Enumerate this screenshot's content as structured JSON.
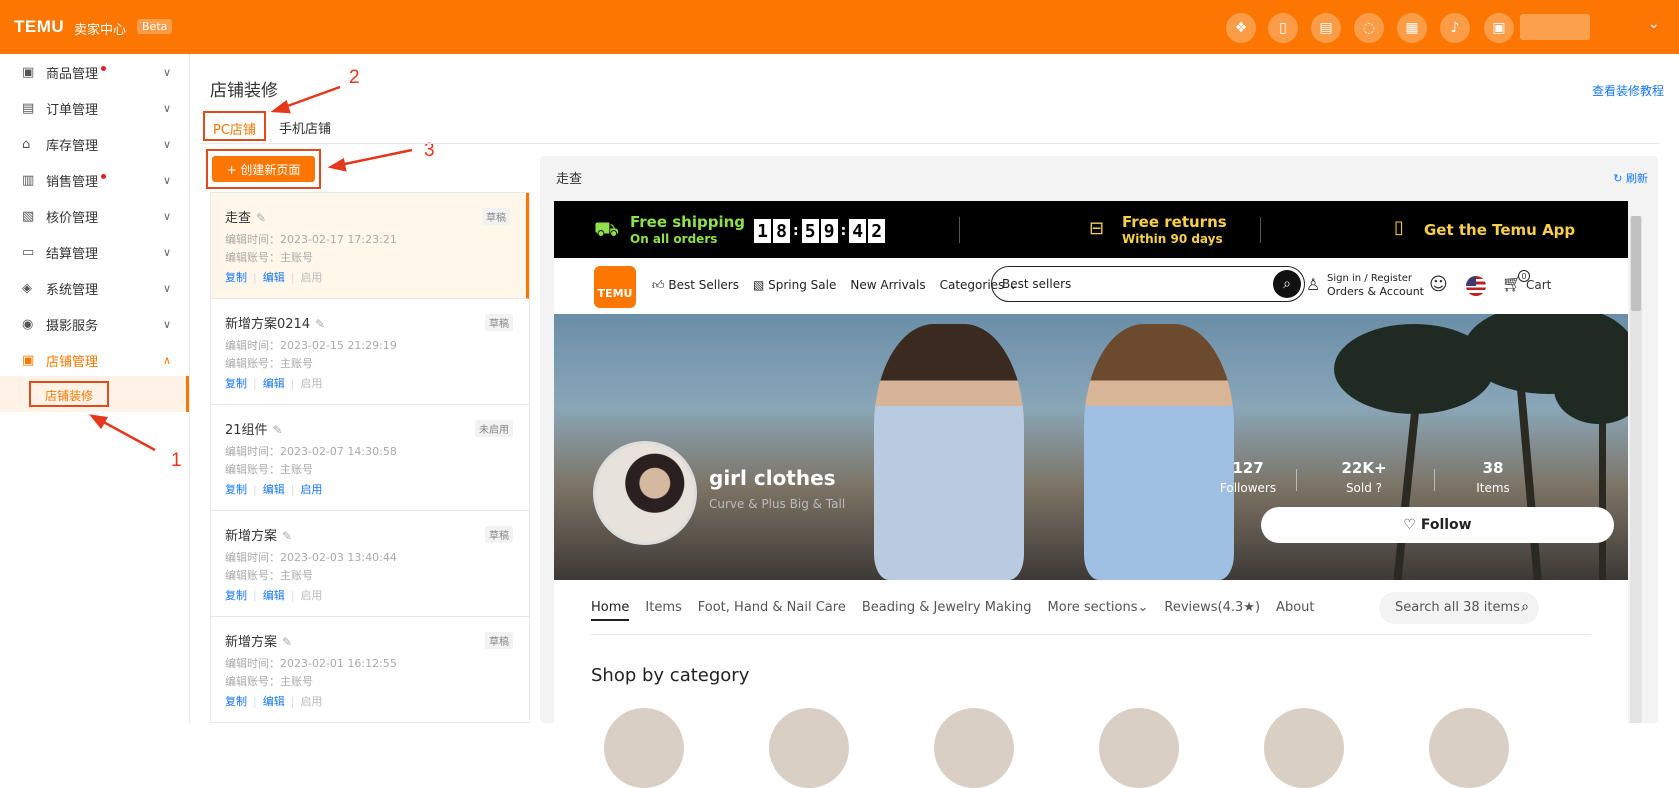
{
  "header": {
    "logo": "TEMU",
    "subtitle": "卖家中心",
    "badge": "Beta",
    "icons": [
      "handshake-icon",
      "phone-icon",
      "book-icon",
      "chat-icon",
      "document-icon",
      "bell-icon",
      "store-icon"
    ]
  },
  "sidebar": {
    "items": [
      {
        "label": "商品管理",
        "icon": "grid-icon",
        "dot": true
      },
      {
        "label": "订单管理",
        "icon": "list-icon",
        "dot": false
      },
      {
        "label": "库存管理",
        "icon": "warehouse-icon",
        "dot": false
      },
      {
        "label": "销售管理",
        "icon": "chart-icon",
        "dot": true
      },
      {
        "label": "核价管理",
        "icon": "price-icon",
        "dot": false
      },
      {
        "label": "结算管理",
        "icon": "wallet-icon",
        "dot": false
      },
      {
        "label": "系统管理",
        "icon": "shield-icon",
        "dot": false
      },
      {
        "label": "摄影服务",
        "icon": "camera-icon",
        "dot": false
      },
      {
        "label": "店铺管理",
        "icon": "shop-icon",
        "dot": false,
        "active": true
      }
    ],
    "subitem": "店铺装修"
  },
  "annotations": {
    "n1": "1",
    "n2": "2",
    "n3": "3"
  },
  "main": {
    "title": "店铺装修",
    "tutorial_link": "查看装修教程",
    "tabs": [
      {
        "label": "PC店铺",
        "active": true
      },
      {
        "label": "手机店铺",
        "active": false
      }
    ],
    "create_button": "+ 创建新页面"
  },
  "pages": [
    {
      "name": "走查",
      "badge": "草稿",
      "time": "编辑时间：2023-02-17 17:23:21",
      "account": "编辑账号：主账号",
      "copy": "复制",
      "edit": "编辑",
      "enable": "启用",
      "enable_active": false,
      "selected": true
    },
    {
      "name": "新增方案0214",
      "badge": "草稿",
      "time": "编辑时间：2023-02-15 21:29:19",
      "account": "编辑账号：主账号",
      "copy": "复制",
      "edit": "编辑",
      "enable": "启用",
      "enable_active": false,
      "selected": false
    },
    {
      "name": "21组件",
      "badge": "未启用",
      "time": "编辑时间：2023-02-07 14:30:58",
      "account": "编辑账号：主账号",
      "copy": "复制",
      "edit": "编辑",
      "enable": "启用",
      "enable_active": true,
      "selected": false
    },
    {
      "name": "新增方案",
      "badge": "草稿",
      "time": "编辑时间：2023-02-03 13:40:44",
      "account": "编辑账号：主账号",
      "copy": "复制",
      "edit": "编辑",
      "enable": "启用",
      "enable_active": false,
      "selected": false
    },
    {
      "name": "新增方案",
      "badge": "草稿",
      "time": "编辑时间：2023-02-01 16:12:55",
      "account": "编辑账号：主账号",
      "copy": "复制",
      "edit": "编辑",
      "enable": "启用",
      "enable_active": false,
      "selected": false
    }
  ],
  "preview": {
    "title": "走查",
    "refresh": "刷新",
    "promo": {
      "shipping_title": "Free shipping",
      "shipping_sub": "On all orders",
      "timer": [
        "1",
        "8",
        "5",
        "9",
        "4",
        "2"
      ],
      "returns_title": "Free returns",
      "returns_sub": "Within 90 days",
      "app": "Get the Temu App"
    },
    "nav": {
      "logo": "TEMU",
      "links": [
        "Best Sellers",
        "Spring Sale",
        "New Arrivals",
        "Categories"
      ],
      "search": "Best sellers",
      "signin": "Sign in / Register",
      "orders": "Orders & Account",
      "cart": "Cart",
      "cart_count": "0"
    },
    "store": {
      "name": "girl clothes",
      "tags": "Curve & Plus   Big & Tall",
      "followers_num": "127",
      "followers_lbl": "Followers",
      "sold_num": "22K+",
      "sold_lbl": "Sold",
      "items_num": "38",
      "items_lbl": "Items",
      "follow": "Follow"
    },
    "store_nav": {
      "links": [
        "Home",
        "Items",
        "Foot, Hand & Nail Care",
        "Beading & Jewelry Making",
        "More sections",
        "Reviews(4.3★)",
        "About"
      ],
      "search": "Search all 38 items",
      "shop_by_category": "Shop by category"
    }
  }
}
